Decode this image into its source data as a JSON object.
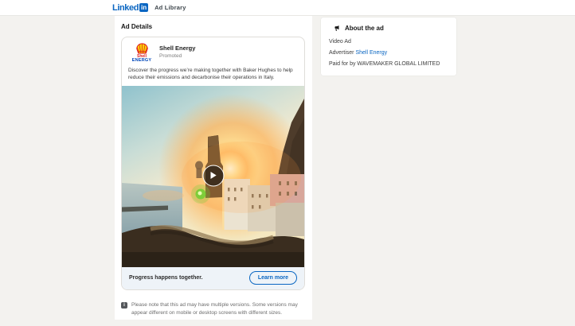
{
  "header": {
    "logo_text": "Linked",
    "logo_badge": "in",
    "app_title": "Ad Library"
  },
  "main": {
    "section_title": "Ad Details",
    "ad_card": {
      "logo_line1": "Shell",
      "logo_line2": "ENERGY",
      "advertiser_name": "Shell Energy",
      "promoted_label": "Promoted",
      "body_text": "Discover the progress we’re making together with Baker Hughes to help reduce their emissions and decarbonise their operations in Italy.",
      "footer": {
        "headline": "Progress happens together.",
        "cta_label": "Learn more"
      }
    },
    "disclaimer": "Please note that this ad may have multiple versions. Some versions may appear different on mobile or desktop screens with different sizes."
  },
  "sidebar": {
    "title": "About the ad",
    "ad_type": "Video Ad",
    "advertiser_label": "Advertiser",
    "advertiser_link": "Shell Energy",
    "paid_for_label": "Paid for by",
    "paid_for_value": "WAVEMAKER GLOBAL LIMITED"
  },
  "icons": {
    "brand": "linkedin-logo",
    "about": "megaphone-icon",
    "video": "play-icon",
    "note": "info-icon",
    "info_glyph": "i"
  },
  "colors": {
    "brand_blue": "#0a66c2",
    "link_blue": "#0a66c2",
    "page_bg": "#f3f2ef",
    "ad_footer_bg": "#eef3f8",
    "shell_red": "#dd1d21",
    "shell_yellow": "#fbce07",
    "shell_navy": "#0047ba"
  }
}
